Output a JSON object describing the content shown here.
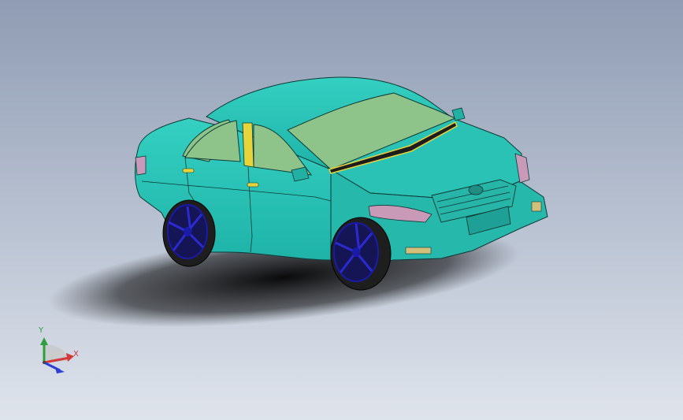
{
  "viewport": {
    "background_top": "#8f9cb3",
    "background_bottom": "#dfe4ec"
  },
  "model": {
    "body_color": "#2ec4b6",
    "glass_color": "#8ec48a",
    "trim_color": "#e7d43a",
    "headlight_color": "#c89ab8",
    "wheel_color": "#1a1aa8",
    "tire_color": "#222222"
  },
  "triad": {
    "x_label": "X",
    "y_label": "Y",
    "x_color": "#d23a3a",
    "y_color": "#2e9e3a",
    "z_color": "#2a3fd6"
  }
}
